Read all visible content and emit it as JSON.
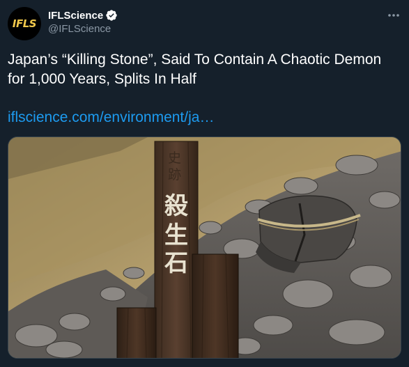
{
  "author": {
    "avatar_text": "IFLS",
    "display_name": "IFLScience",
    "handle": "@IFLScience",
    "verified": true
  },
  "tweet": {
    "text": "Japan’s “Killing Stone”, Said To Contain A Chaotic Demon for 1,000 Years, Splits In Half",
    "link": "iflscience.com/environment/ja…"
  },
  "media": {
    "signpost_main_text": [
      "殺",
      "生",
      "石"
    ],
    "signpost_top_text": [
      "史",
      "跡"
    ]
  },
  "colors": {
    "background": "#15202b",
    "link": "#1d9bf0",
    "secondary_text": "#8b98a5",
    "verified": "#ffffff",
    "avatar_logo": "#f2c94c"
  },
  "icons": {
    "verified": "verified-badge-icon",
    "more": "more-options-icon"
  }
}
